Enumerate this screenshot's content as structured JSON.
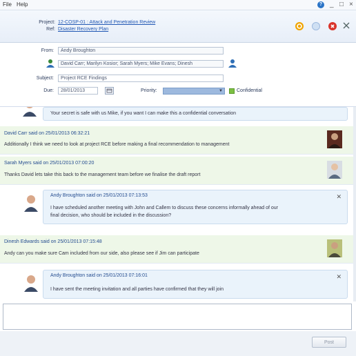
{
  "menu": {
    "file": "File",
    "help": "Help"
  },
  "window_controls": {
    "help_icon": "?",
    "minimize": "_",
    "maximize": "□",
    "close": "×"
  },
  "header": {
    "project_label": "Project:",
    "project_value": "12-COSP-01 : Attack and Penetration Review",
    "ref_label": "Ref:",
    "ref_value": "Disaster Recovery Plan"
  },
  "form": {
    "from_label": "From:",
    "from_value": "Andy Broughton",
    "to_value": "David Carr; Marilyn Kosior; Sarah Myers; Mike Evans; Dinesh",
    "subject_label": "Subject:",
    "subject_value": "Project RCE Findings",
    "due_label": "Due:",
    "due_value": "28/01/2013",
    "priority_label": "Priority:",
    "confidential_label": "Confidential"
  },
  "messages": [
    {
      "type": "self-partial",
      "text": "Your secret is safe with us Mike, if you want I can make this a confidential conversation"
    },
    {
      "type": "other",
      "header": "David Carr said on 25/01/2013 06:32:21",
      "text": "Additionally I think we need to look at project RCE before making a final recommendation to management"
    },
    {
      "type": "other",
      "header": "Sarah Myers said on 25/01/2013 07:00:20",
      "text": "Thanks David lets take this back to the management team before we finalise the draft report"
    },
    {
      "type": "self",
      "header": "Andy Broughton said on 25/01/2013 07:13:53",
      "text1": "I have scheduled another meeting with John and Callem to discuss these concerns informally ahead of our",
      "text2": "final decision, who should be included in the discussion?"
    },
    {
      "type": "other",
      "header": "Dinesh Edwards said on 25/01/2013 07:15:48",
      "text": "Andy can you make sure Cam included from our side, also please see if Jim can participate"
    },
    {
      "type": "self",
      "header": "Andy Broughton said on 25/01/2013 07:16:01",
      "text1": "I have sent the meeting invitation and all parties have confirmed that they will join",
      "text2": ""
    }
  ],
  "compose": {
    "value": ""
  },
  "footer": {
    "post_label": "Post"
  },
  "colors": {
    "accent_link": "#1f56b3",
    "other_msg_bg": "#eef7e8",
    "self_bubble_bg": "#eaf3fb",
    "priority_select": "#9db9de",
    "confidential_check": "#7cc043"
  }
}
